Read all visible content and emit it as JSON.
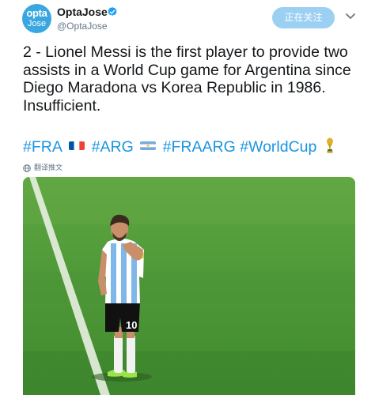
{
  "header": {
    "avatar_line1": "opta",
    "avatar_line2": "Jose",
    "display_name": "OptaJose",
    "handle": "@OptaJose",
    "follow_label": "正在关注"
  },
  "tweet": {
    "text": "2 - Lionel Messi is the first player to provide two assists in a World Cup game for Argentina since Diego Maradona vs Korea Republic in 1986. Insufficient.",
    "hashtags": [
      "#FRA",
      "#ARG",
      "#FRAARG",
      "#WorldCup"
    ],
    "translate_label": "翻译推文"
  },
  "photo": {
    "shirt_number": "10"
  },
  "colors": {
    "brand_blue": "#1b95e0",
    "follow_button": "#9cd0f3",
    "avatar": "#3aa7e0",
    "pitch_green": "#4e9a3a"
  },
  "icons": [
    "verified-badge-icon",
    "chevron-down-icon",
    "france-flag-icon",
    "argentina-flag-icon",
    "world-cup-trophy-icon",
    "globe-icon"
  ]
}
